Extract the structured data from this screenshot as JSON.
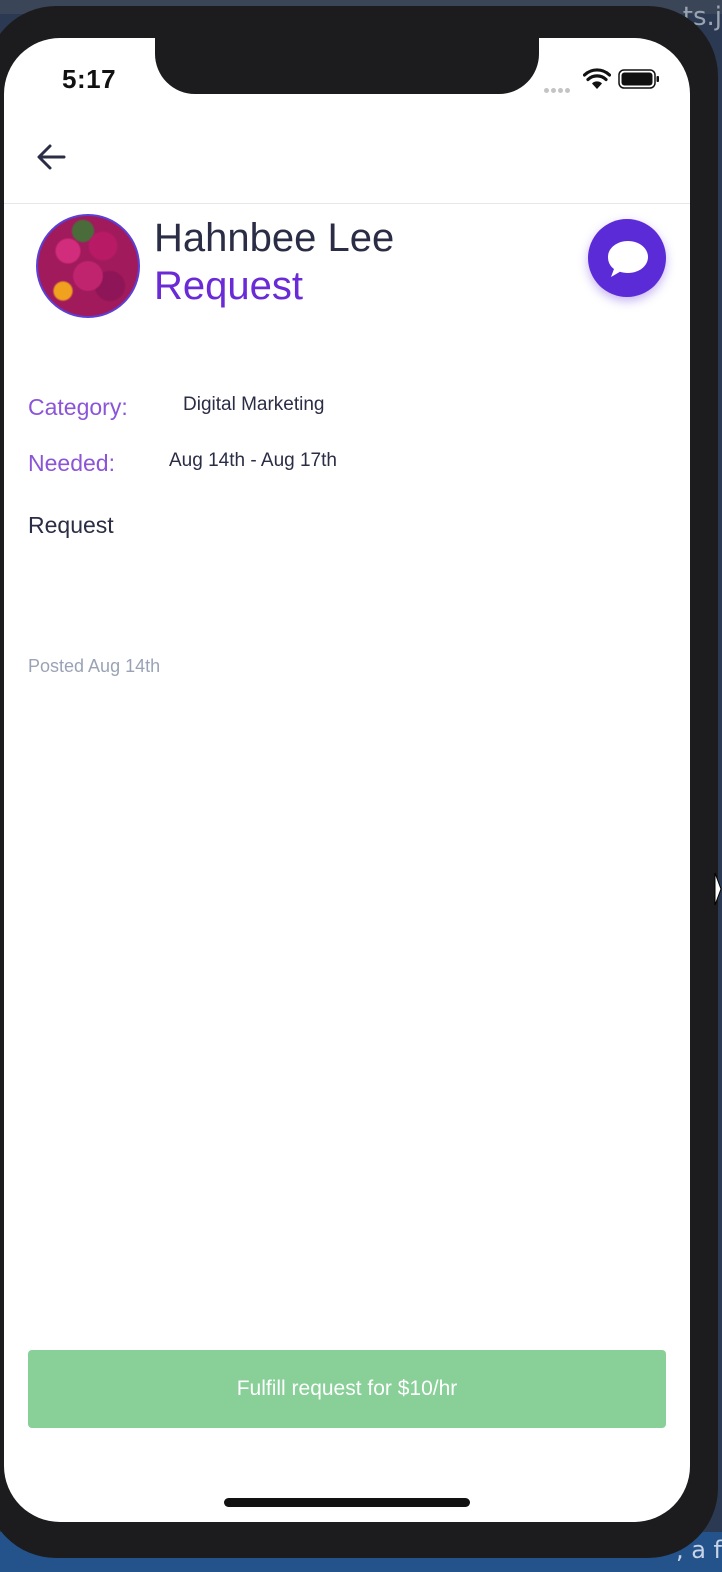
{
  "background": {
    "right_text": "ts.j",
    "bottom_text": ", a f"
  },
  "status_bar": {
    "time": "5:17"
  },
  "header": {
    "back_icon": "arrow-left-icon"
  },
  "profile": {
    "name": "Hahnbee Lee",
    "title": "Request",
    "chat_icon": "chat-bubble-icon"
  },
  "details": {
    "category_label": "Category:",
    "category_value": "Digital Marketing",
    "needed_label": "Needed:",
    "needed_value": "Aug 14th - Aug 17th",
    "request_heading": "Request",
    "posted": "Posted Aug 14th"
  },
  "action": {
    "fulfill_label": "Fulfill request for $10/hr"
  },
  "colors": {
    "accent": "#6a2bd6",
    "chat_button": "#5b2bd8",
    "label": "#8b55d8",
    "fulfill_button": "#88cf98"
  }
}
